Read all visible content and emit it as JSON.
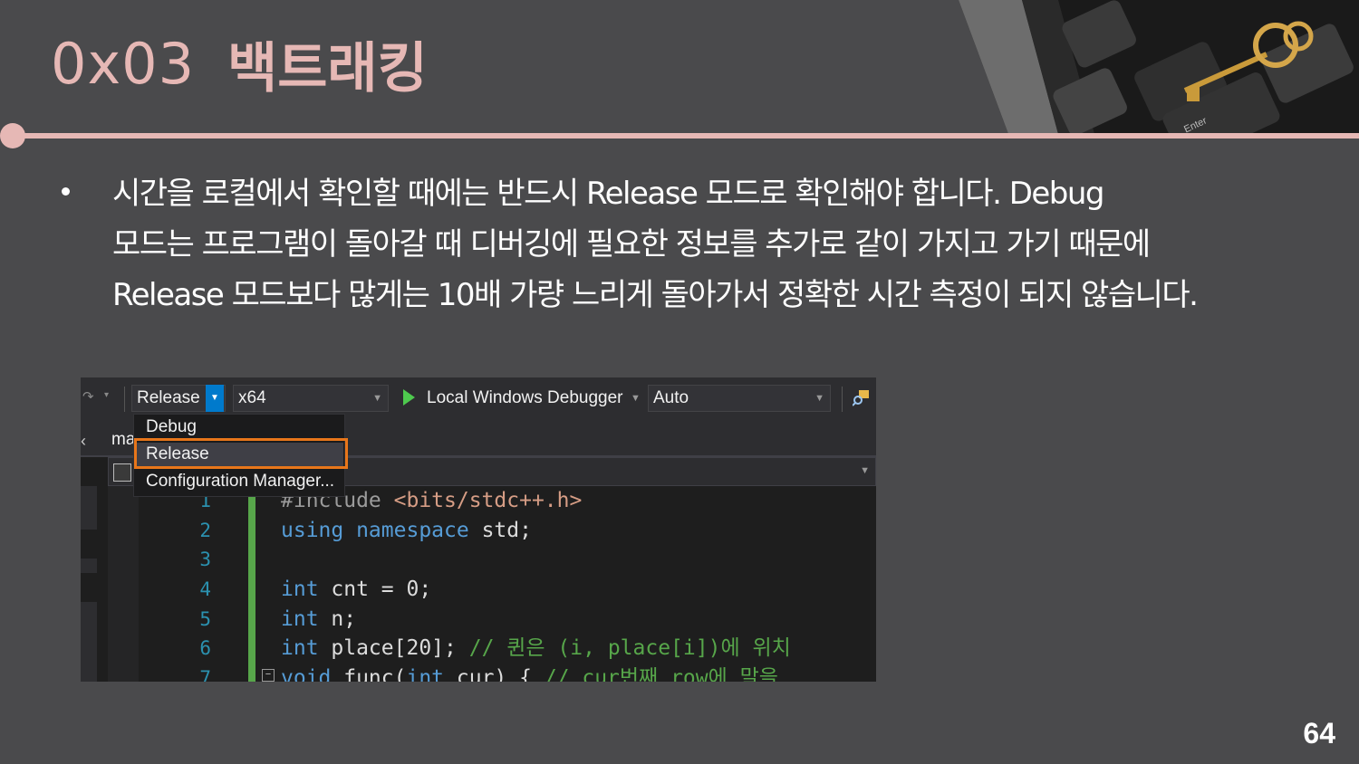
{
  "slide": {
    "title_number": "0x03",
    "title_text": "백트래킹",
    "body_lines": [
      "시간을 로컬에서 확인할 때에는 반드시 Release 모드로 확인해야 합니다. Debug",
      "모드는 프로그램이 돌아갈 때 디버깅에 필요한 정보를 추가로 같이 가지고 가기 때문에",
      "Release 모드보다 많게는 10배 가량 느리게 돌아가서 정확한 시간 측정이 되지 않습니다."
    ],
    "page_number": "64",
    "accent_color": "#e6b8b5",
    "keyboard_key_label": "Enter"
  },
  "ide": {
    "toolbar": {
      "config_value": "Release",
      "platform_value": "x64",
      "debugger_label": "Local Windows Debugger",
      "solution_value": "Auto"
    },
    "config_menu": {
      "items": [
        "Debug",
        "Release",
        "Configuration Manager..."
      ],
      "highlighted": "Release",
      "highlight_color": "#e8761a"
    },
    "tab_partial": "ma",
    "line_numbers": [
      "1",
      "2",
      "3",
      "4",
      "5",
      "6",
      "7"
    ],
    "code": {
      "l1_pre": "#include ",
      "l1_str": "<bits/stdc++.h>",
      "l2_kw": "using namespace",
      "l2_rest": " std;",
      "l4_kw": "int",
      "l4_rest": " cnt = 0;",
      "l5_kw": "int",
      "l5_rest": " n;",
      "l6_kw": "int",
      "l6_rest": " place[20]; ",
      "l6_cmt": "// 퀸은 (i, place[i])에 위치",
      "l7_kw": "void",
      "l7_mid": " func(",
      "l7_kw2": "int",
      "l7_rest": " cur) { ",
      "l7_cmt": "// cur번째 row에 말을"
    }
  }
}
